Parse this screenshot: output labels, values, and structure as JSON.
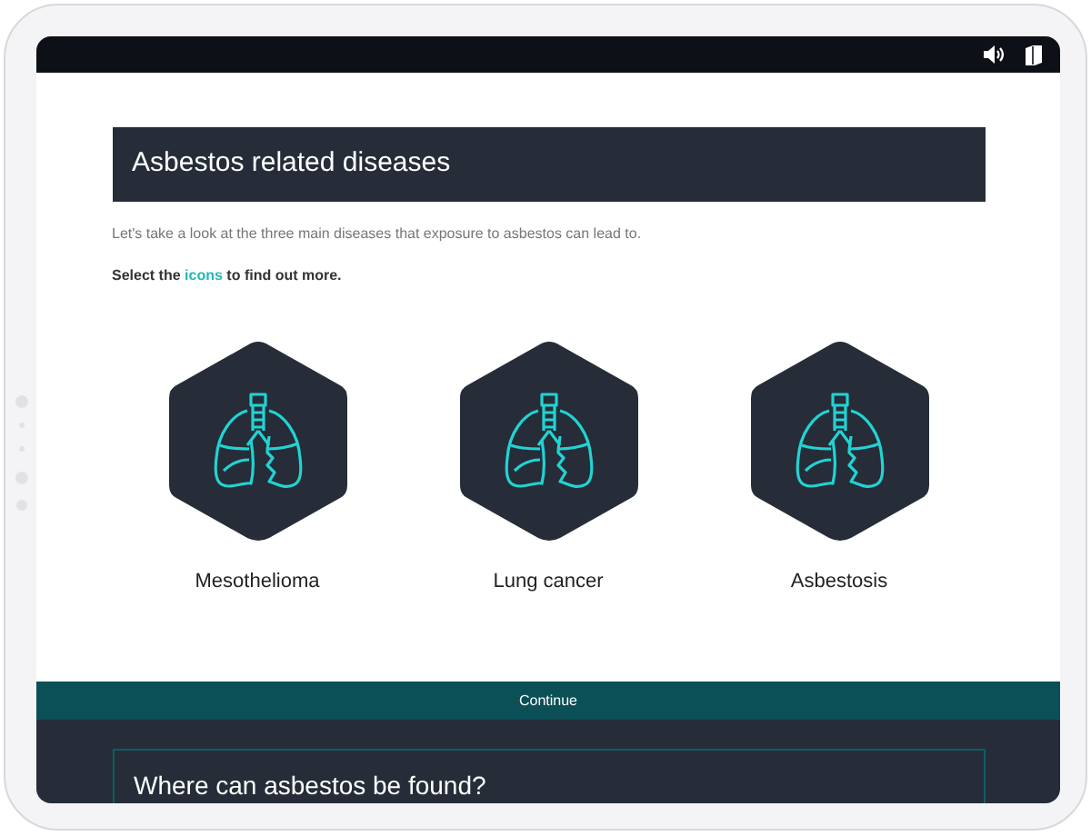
{
  "heading": "Asbestos related diseases",
  "intro": "Let's take a look at the three main diseases that exposure to asbestos can lead to.",
  "instruction": {
    "before": "Select the",
    "link": "icons",
    "after": "to find out more."
  },
  "diseases": [
    {
      "label": "Mesothelioma"
    },
    {
      "label": "Lung cancer"
    },
    {
      "label": "Asbestosis"
    }
  ],
  "continue_button": "Continue",
  "next_section": {
    "title": "Where can asbestos be found?"
  }
}
